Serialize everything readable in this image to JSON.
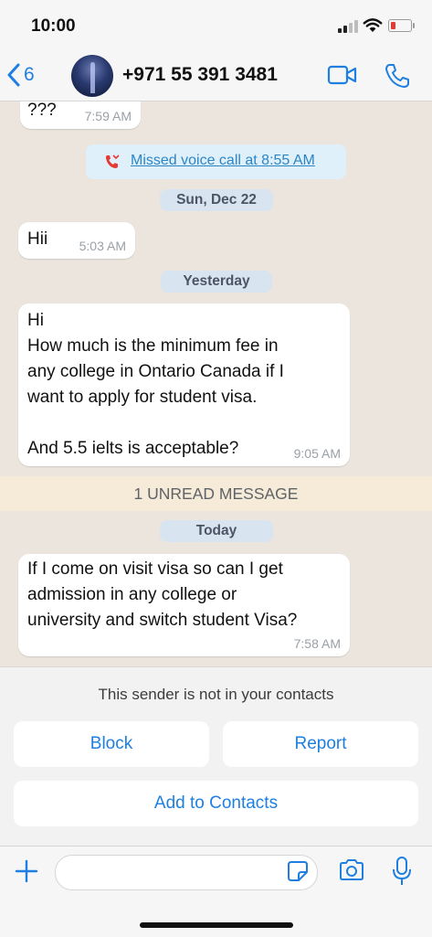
{
  "status": {
    "time": "10:00"
  },
  "header": {
    "back_count": "6",
    "contact": "+971 55 391 3481"
  },
  "messages": {
    "m0": {
      "text": "???",
      "time": "7:59 AM"
    },
    "missed_call": "Missed voice call at 8:55 AM",
    "date1": "Sun, Dec 22",
    "m1": {
      "text": "Hii",
      "time": "5:03 AM"
    },
    "date2": "Yesterday",
    "m2": {
      "line1": "Hi",
      "line2": "How much is the minimum fee in",
      "line3": "any college in Ontario Canada if I",
      "line4": "want to apply for student visa.",
      "line5": "And 5.5 ielts is acceptable?",
      "time": "9:05 AM"
    },
    "unread": "1 UNREAD MESSAGE",
    "date3": "Today",
    "m3": {
      "line1": "If I come on visit visa so can I get",
      "line2": "admission in any college or",
      "line3": "university and switch student Visa?",
      "time": "7:58 AM"
    }
  },
  "panel": {
    "notice": "This sender is not in your contacts",
    "block": "Block",
    "report": "Report",
    "add": "Add to Contacts"
  },
  "colors": {
    "accent": "#1f7fe0",
    "missed_call_red": "#e53935"
  },
  "icons": [
    "chevron-left-icon",
    "video-icon",
    "phone-icon",
    "missed-call-icon",
    "plus-icon",
    "sticker-icon",
    "camera-icon",
    "mic-icon"
  ]
}
